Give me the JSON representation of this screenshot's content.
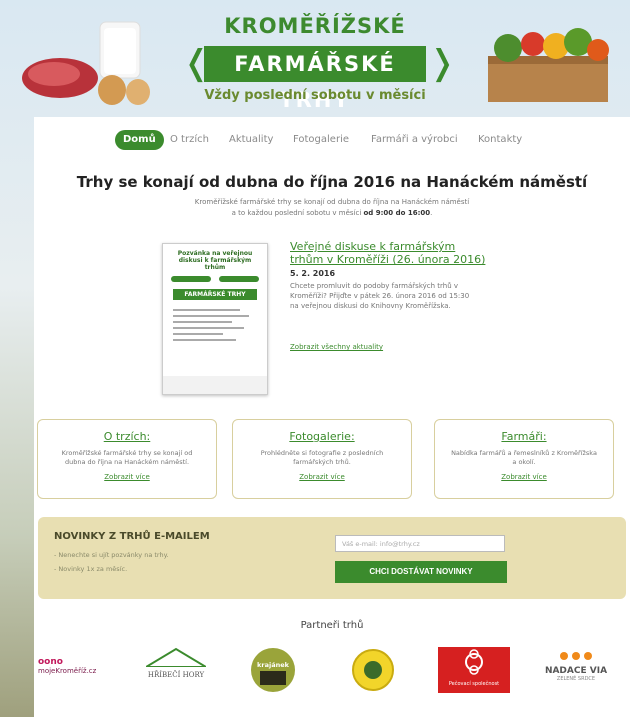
{
  "header": {
    "brand_top": "KROMĚŘÍŽSKÉ",
    "brand_main": "FARMÁŘSKÉ TRHY",
    "brand_sub": "Vždy poslední sobotu v měsíci",
    "chevron_left": "❬",
    "chevron_right": "❭"
  },
  "nav": {
    "items": [
      {
        "label": "Domů",
        "active": true
      },
      {
        "label": "O trzích",
        "active": false
      },
      {
        "label": "Aktuality",
        "active": false
      },
      {
        "label": "Fotogalerie",
        "active": false
      },
      {
        "label": "Farmáři a výrobci",
        "active": false
      },
      {
        "label": "Kontakty",
        "active": false
      }
    ]
  },
  "main": {
    "headline": "Trhy se konají od dubna do října 2016 na Hanáckém náměstí",
    "intro_line1": "Kroměřížské farmářské trhy se konají od dubna do října na Hanáckém náměstí",
    "intro_line2": "a to každou poslední sobotu v měsíci",
    "intro_time": "od 9:00 do 16:00",
    "intro_end": "."
  },
  "poster": {
    "head": "Pozvánka na veřejnou diskusi k farmářským trhům",
    "main_label": "FARMÁŘSKÉ TRHY"
  },
  "news": {
    "title": "Veřejné diskuse k farmářským trhům v Kroměříži (26. února 2016)",
    "date": "5. 2. 2016",
    "text": "Chcete promluvit do podoby farmářských trhů v Kroměříži? Přijďte v pátek 26. února 2016 od 15:30 na veřejnou diskusi do Knihovny Kroměřížska.",
    "link": "Zobrazit všechny aktuality"
  },
  "boxes": [
    {
      "title": "O trzích:",
      "text": "Kroměřížské farmářské trhy se konají od dubna do října na Hanáckém náměstí.",
      "link": "Zobrazit více"
    },
    {
      "title": "Fotogalerie:",
      "text": "Prohlédněte si fotografie z posledních farmářských trhů.",
      "link": "Zobrazit více"
    },
    {
      "title": "Farmáři:",
      "text": "Nabídka farmářů a řemeslníků z Kroměřížska a okolí.",
      "link": "Zobrazit více"
    }
  ],
  "newsletter": {
    "title": "NOVINKY Z TRHŮ E-MAILEM",
    "item1": "- Nenechte si ujít pozvánky na trhy.",
    "item2": "- Novinky 1x za měsíc.",
    "placeholder": "Váš e-mail: info@trhy.cz",
    "button": "CHCI DOSTÁVAT NOVINKY"
  },
  "partners": {
    "title": "Partneři trhů",
    "logo1_a": "oono",
    "logo1_b": "mojeKroměříž.cz",
    "logo2": "HŘÍBEČÍ HORY",
    "logo3": "krajánek",
    "logo5": "Pečovací společnost",
    "logo6_a": "NADACE VIA",
    "logo6_b": "ZELENÉ SRDCE"
  },
  "colors": {
    "brand_green": "#3b8b2d",
    "newsletter_bg": "#e8dfb2",
    "box_border": "#d8cf9e"
  }
}
